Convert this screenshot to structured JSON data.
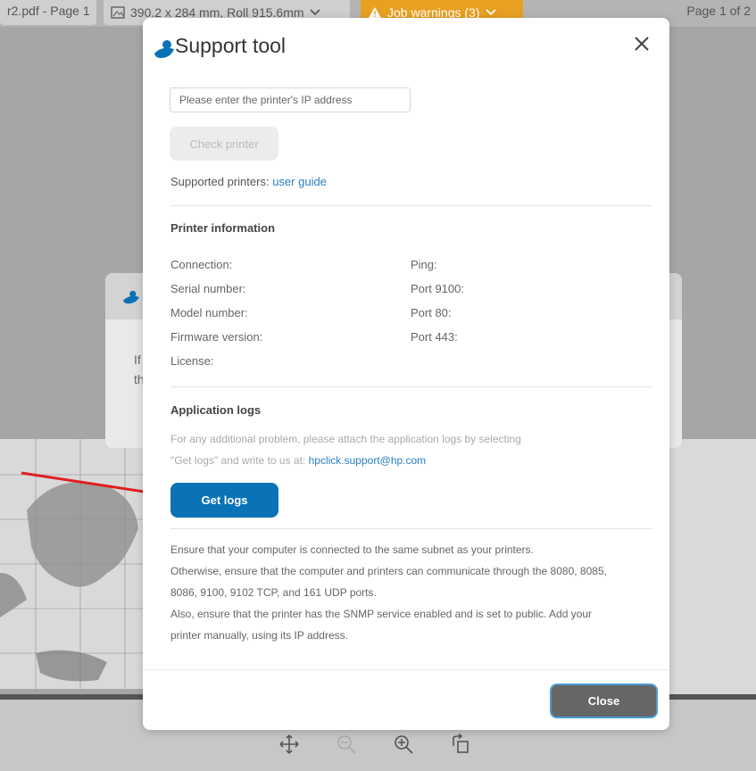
{
  "background": {
    "file_tab": "r2.pdf - Page 1",
    "size_tab": "390.2 x 284 mm, Roll 915.6mm",
    "warning_tab": "Job warnings (3)",
    "page_count": "Page 1 of 2",
    "dialog_text_line1": "If",
    "dialog_text_line2": "th"
  },
  "modal": {
    "title": "Support tool",
    "ip_placeholder": "Please enter the printer's IP address",
    "check_button": "Check printer",
    "supported_prefix": "Supported printers:",
    "supported_link": "user guide",
    "printer_info": {
      "title": "Printer information",
      "left": [
        "Connection:",
        "Serial number:",
        "Model number:",
        "Firmware version:",
        "License:"
      ],
      "right": [
        "Ping:",
        "Port 9100:",
        "Port 80:",
        "Port 443:"
      ]
    },
    "logs": {
      "title": "Application logs",
      "desc_line1": "For any additional problem, please attach the application logs by selecting",
      "desc_line2_prefix": "\"Get logs\" and write to us at:",
      "email": "hpclick.support@hp.com",
      "button": "Get logs"
    },
    "notes": [
      "Ensure that your computer is connected to the same subnet as your printers.",
      "Otherwise, ensure that the computer and printers can communicate through the 8080, 8085,",
      "8086, 9100, 9102 TCP, and 161 UDP ports.",
      "Also, ensure that the printer has the SNMP service enabled and is set to public. Add your",
      "printer manually, using its IP address."
    ],
    "close_button": "Close"
  },
  "colors": {
    "accent": "#0a73b5",
    "link": "#2a7fbf",
    "warning": "#e8a021",
    "annotation_arrow": "#e02020"
  }
}
